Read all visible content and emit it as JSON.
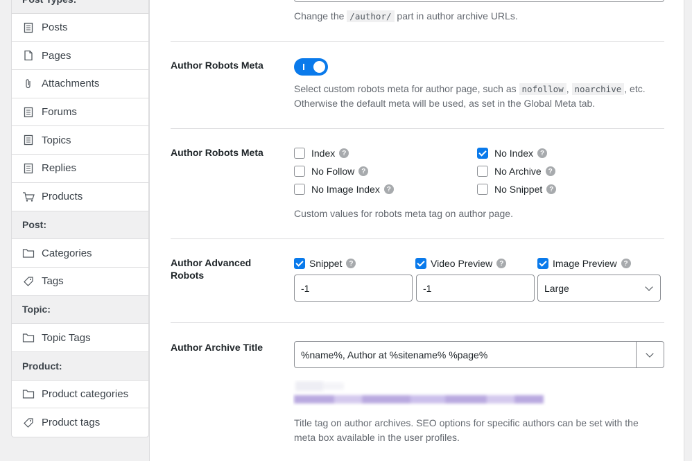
{
  "sidebar": {
    "section_top": "Post Types:",
    "items_post_types": [
      {
        "icon": "page-icon",
        "label": "Posts"
      },
      {
        "icon": "pages-icon",
        "label": "Pages"
      },
      {
        "icon": "paperclip-icon",
        "label": "Attachments"
      },
      {
        "icon": "page-icon",
        "label": "Forums"
      },
      {
        "icon": "page-icon",
        "label": "Topics"
      },
      {
        "icon": "page-icon",
        "label": "Replies"
      },
      {
        "icon": "cart-icon",
        "label": "Products"
      }
    ],
    "section_post": "Post:",
    "items_post": [
      {
        "icon": "folder-icon",
        "label": "Categories"
      },
      {
        "icon": "tag-icon",
        "label": "Tags"
      }
    ],
    "section_topic": "Topic:",
    "items_topic": [
      {
        "icon": "folder-icon",
        "label": "Topic Tags"
      }
    ],
    "section_product": "Product:",
    "items_product": [
      {
        "icon": "folder-icon",
        "label": "Product categories"
      },
      {
        "icon": "tag-icon",
        "label": "Product tags"
      }
    ]
  },
  "author_base": {
    "desc_before": "Change the",
    "code": "/author/",
    "desc_after": "part in author archive URLs."
  },
  "robots_meta_toggle": {
    "label": "Author Robots Meta",
    "enabled": true,
    "desc1_before": "Select custom robots meta for author page, such as",
    "code1": "nofollow",
    "sep": ",",
    "code2": "noarchive",
    "desc1_after": ", etc.",
    "desc2": "Otherwise the default meta will be used, as set in the Global Meta tab."
  },
  "robots_meta": {
    "label": "Author Robots Meta",
    "options": {
      "index": {
        "label": "Index",
        "checked": false
      },
      "noindex": {
        "label": "No Index",
        "checked": true
      },
      "nofollow": {
        "label": "No Follow",
        "checked": false
      },
      "noarchive": {
        "label": "No Archive",
        "checked": false
      },
      "noimageindex": {
        "label": "No Image Index",
        "checked": false
      },
      "nosnippet": {
        "label": "No Snippet",
        "checked": false
      }
    },
    "desc": "Custom values for robots meta tag on author page."
  },
  "advanced_robots": {
    "label_line1": "Author Advanced",
    "label_line2": "Robots",
    "snippet": {
      "label": "Snippet",
      "checked": true,
      "value": "-1"
    },
    "video": {
      "label": "Video Preview",
      "checked": true,
      "value": "-1"
    },
    "image": {
      "label": "Image Preview",
      "checked": true,
      "value": "Large"
    }
  },
  "archive_title": {
    "label": "Author Archive Title",
    "value": "%name%, Author at %sitename% %page%",
    "desc1": "Title tag on author archives. SEO options for specific authors can be set with the",
    "desc2": "meta box available in the user profiles."
  },
  "colors": {
    "accent": "#0a7aeb",
    "blur": "#b9a9e0"
  }
}
